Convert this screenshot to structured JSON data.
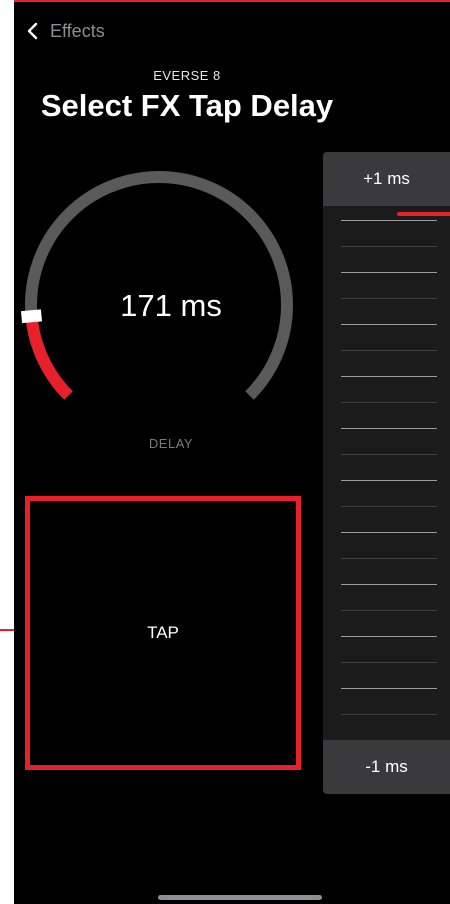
{
  "nav": {
    "back_label": "Effects"
  },
  "header": {
    "device": "EVERSE 8",
    "title": "Select FX Tap Delay"
  },
  "dial": {
    "value_text": "171 ms",
    "label": "DELAY",
    "fraction": 0.148
  },
  "tap": {
    "label": "TAP"
  },
  "ruler": {
    "increment_label": "+1 ms",
    "decrement_label": "-1 ms"
  },
  "colors": {
    "accent": "#e8202a",
    "track": "#5a5a5a",
    "background": "#000000"
  }
}
